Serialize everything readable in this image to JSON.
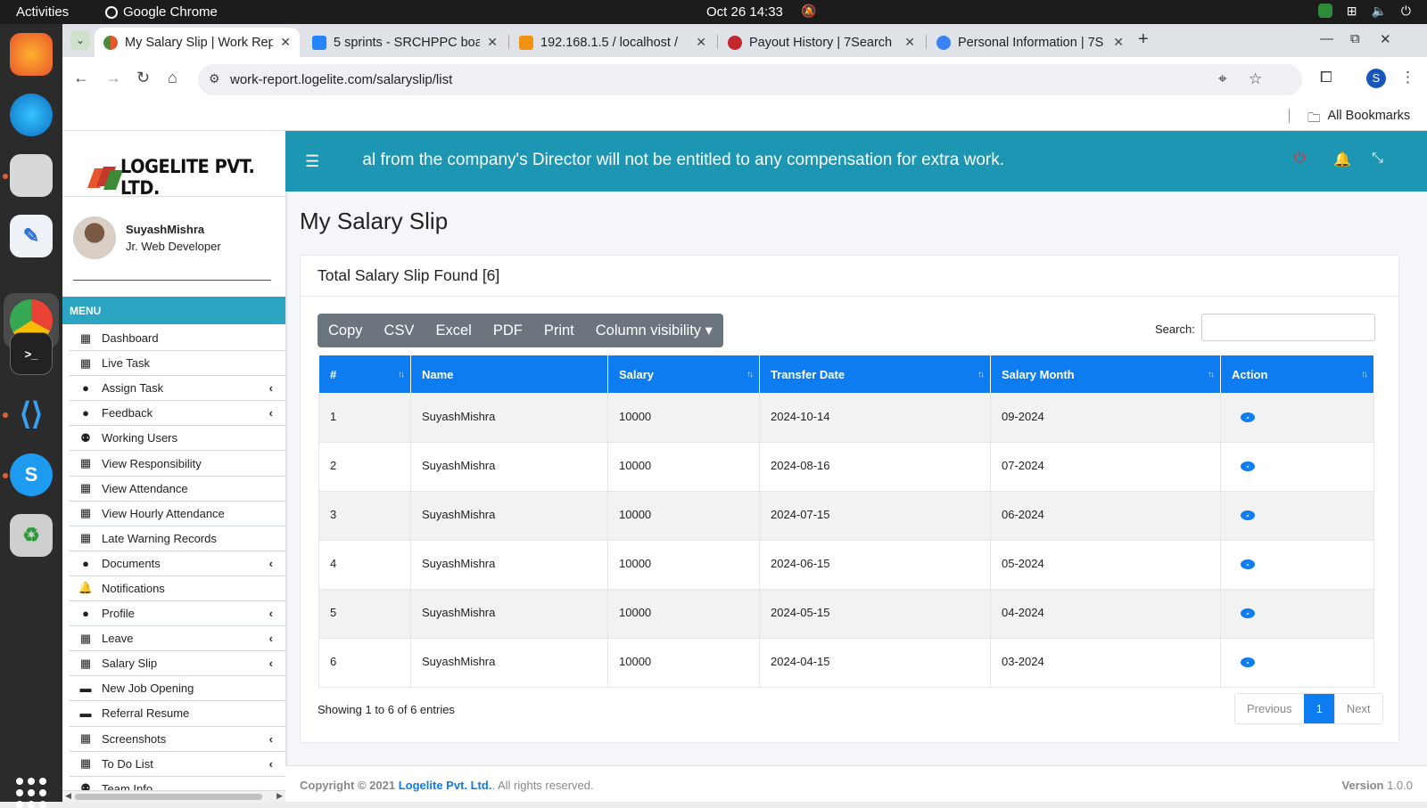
{
  "os": {
    "activities": "Activities",
    "app_name": "Google Chrome",
    "clock": "Oct 26  14:33"
  },
  "browser": {
    "tabs": [
      {
        "title": "My Salary Slip | Work Rep",
        "active": true
      },
      {
        "title": "5 sprints - SRCHPPC boa",
        "active": false
      },
      {
        "title": "192.168.1.5 / localhost /",
        "active": false
      },
      {
        "title": "Payout History | 7Search",
        "active": false
      },
      {
        "title": "Personal Information | 7S",
        "active": false
      }
    ],
    "url": "work-report.logelite.com/salaryslip/list",
    "profile_initial": "S",
    "all_bookmarks": "All Bookmarks"
  },
  "sidebar": {
    "logo_text": "LOGELITE PVT. LTD.",
    "user_name": "SuyashMishra",
    "user_role": "Jr. Web Developer",
    "menu_header": "MENU",
    "items": [
      {
        "label": "Dashboard",
        "icon": "calendar-icon",
        "glyph": "▦",
        "submenu": false
      },
      {
        "label": "Live Task",
        "icon": "calendar-icon",
        "glyph": "▦",
        "submenu": false
      },
      {
        "label": "Assign Task",
        "icon": "user-icon",
        "glyph": "●",
        "submenu": true
      },
      {
        "label": "Feedback",
        "icon": "user-icon",
        "glyph": "●",
        "submenu": true
      },
      {
        "label": "Working Users",
        "icon": "users-icon",
        "glyph": "⚉",
        "submenu": false
      },
      {
        "label": "View Responsibility",
        "icon": "calendar-icon",
        "glyph": "▦",
        "submenu": false
      },
      {
        "label": "View Attendance",
        "icon": "calendar-icon",
        "glyph": "▦",
        "submenu": false
      },
      {
        "label": "View Hourly Attendance",
        "icon": "calendar-icon",
        "glyph": "▦",
        "submenu": false
      },
      {
        "label": "Late Warning Records",
        "icon": "calendar-icon",
        "glyph": "▦",
        "submenu": false
      },
      {
        "label": "Documents",
        "icon": "user-icon",
        "glyph": "●",
        "submenu": true
      },
      {
        "label": "Notifications",
        "icon": "bell-icon",
        "glyph": "🔔",
        "submenu": false
      },
      {
        "label": "Profile",
        "icon": "user-icon",
        "glyph": "●",
        "submenu": true
      },
      {
        "label": "Leave",
        "icon": "calendar-icon",
        "glyph": "▦",
        "submenu": true
      },
      {
        "label": "Salary Slip",
        "icon": "calendar-icon",
        "glyph": "▦",
        "submenu": true
      },
      {
        "label": "New Job Opening",
        "icon": "briefcase-icon",
        "glyph": "▬",
        "submenu": false
      },
      {
        "label": "Referral Resume",
        "icon": "briefcase-icon",
        "glyph": "▬",
        "submenu": false
      },
      {
        "label": "Screenshots",
        "icon": "calendar-icon",
        "glyph": "▦",
        "submenu": true
      },
      {
        "label": "To Do List",
        "icon": "calendar-icon",
        "glyph": "▦",
        "submenu": true
      },
      {
        "label": "Team Info",
        "icon": "users-icon",
        "glyph": "⚉",
        "submenu": false
      }
    ]
  },
  "header": {
    "marquee": "al from the company's Director will not be entitled to any compensation for extra work."
  },
  "main": {
    "page_title": "My Salary Slip",
    "card_title": "Total Salary Slip Found [6]",
    "buttons": [
      "Copy",
      "CSV",
      "Excel",
      "PDF",
      "Print",
      "Column visibility ▾"
    ],
    "search_label": "Search:",
    "columns": [
      "#",
      "Name",
      "Salary",
      "Transfer Date",
      "Salary Month",
      "Action"
    ],
    "rows": [
      [
        "1",
        "SuyashMishra",
        "10000",
        "2024-10-14",
        "09-2024"
      ],
      [
        "2",
        "SuyashMishra",
        "10000",
        "2024-08-16",
        "07-2024"
      ],
      [
        "3",
        "SuyashMishra",
        "10000",
        "2024-07-15",
        "06-2024"
      ],
      [
        "4",
        "SuyashMishra",
        "10000",
        "2024-06-15",
        "05-2024"
      ],
      [
        "5",
        "SuyashMishra",
        "10000",
        "2024-05-15",
        "04-2024"
      ],
      [
        "6",
        "SuyashMishra",
        "10000",
        "2024-04-15",
        "03-2024"
      ]
    ],
    "info": "Showing 1 to 6 of 6 entries",
    "pager": {
      "prev": "Previous",
      "current": "1",
      "next": "Next"
    }
  },
  "footer": {
    "copyright_prefix": "Copyright © 2021 ",
    "company": "Logelite Pvt. Ltd.",
    "rights": ". All rights reserved.",
    "version_label": "Version",
    "version": "1.0.0"
  },
  "colors": {
    "header_bg": "#1c96b3",
    "menu_header_bg": "#2ba5c1",
    "table_header_bg": "#0d7cf0",
    "button_group_bg": "#6c757d"
  }
}
